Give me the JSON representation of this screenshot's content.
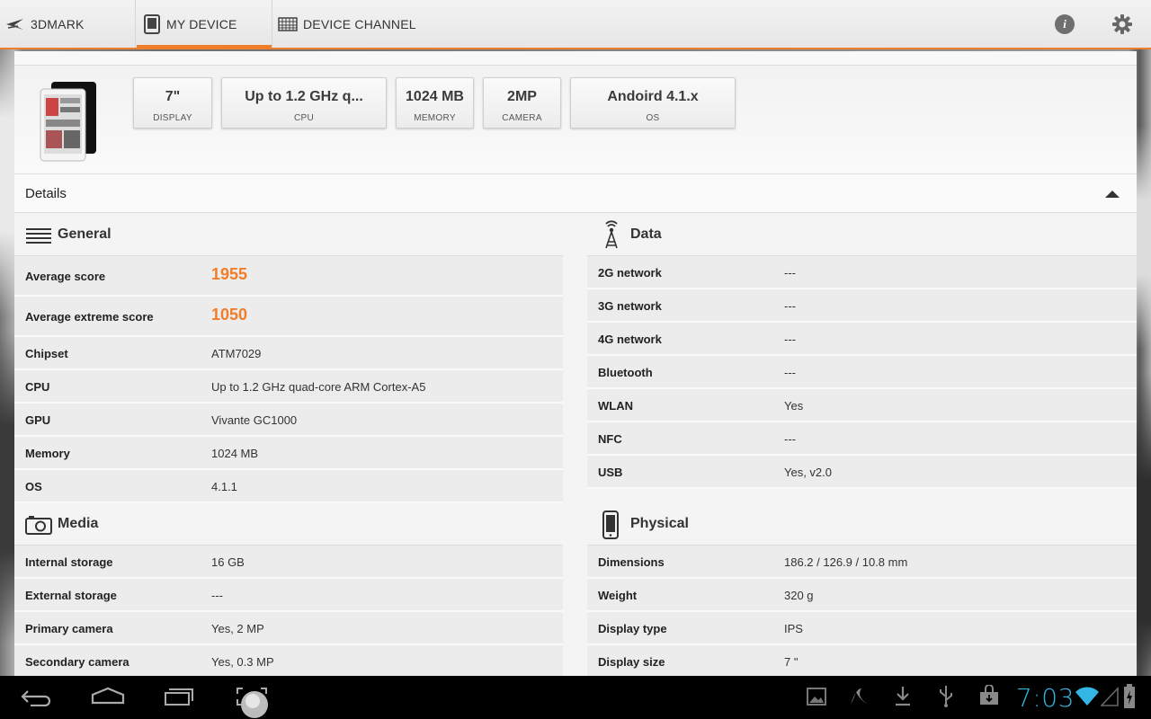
{
  "topbar": {
    "tabs": [
      {
        "label": "3DMARK"
      },
      {
        "label": "MY DEVICE",
        "selected": true
      },
      {
        "label": "DEVICE CHANNEL"
      }
    ],
    "info_icon_glyph": "i",
    "accent_color": "#f07d2a"
  },
  "summary": {
    "cards": [
      {
        "value": "7\"",
        "key": "DISPLAY"
      },
      {
        "value": "Up to 1.2 GHz q...",
        "key": "CPU"
      },
      {
        "value": "1024 MB",
        "key": "MEMORY"
      },
      {
        "value": "2MP",
        "key": "CAMERA"
      },
      {
        "value": "Andoird 4.1.x",
        "key": "OS"
      }
    ]
  },
  "details": {
    "title": "Details",
    "general": {
      "title": "General",
      "rows": [
        {
          "key": "Average score",
          "value": "1955"
        },
        {
          "key": "Average extreme score",
          "value": "1050"
        },
        {
          "key": "Chipset",
          "value": "ATM7029"
        },
        {
          "key": "CPU",
          "value": "Up to 1.2 GHz quad-core ARM Cortex-A5"
        },
        {
          "key": "GPU",
          "value": "Vivante GC1000"
        },
        {
          "key": "Memory",
          "value": "1024 MB"
        },
        {
          "key": "OS",
          "value": "4.1.1"
        }
      ]
    },
    "data": {
      "title": "Data",
      "rows": [
        {
          "key": "2G network",
          "value": "---"
        },
        {
          "key": "3G network",
          "value": "---"
        },
        {
          "key": "4G network",
          "value": "---"
        },
        {
          "key": "Bluetooth",
          "value": "---"
        },
        {
          "key": "WLAN",
          "value": "Yes"
        },
        {
          "key": "NFC",
          "value": "---"
        },
        {
          "key": "USB",
          "value": "Yes, v2.0"
        }
      ]
    },
    "media": {
      "title": "Media",
      "rows": [
        {
          "key": "Internal storage",
          "value": "16 GB"
        },
        {
          "key": "External storage",
          "value": "---"
        },
        {
          "key": "Primary camera",
          "value": "Yes, 2 MP"
        },
        {
          "key": "Secondary camera",
          "value": "Yes, 0.3 MP"
        }
      ]
    },
    "physical": {
      "title": "Physical",
      "rows": [
        {
          "key": "Dimensions",
          "value": "186.2 / 126.9 / 10.8 mm"
        },
        {
          "key": "Weight",
          "value": "320 g"
        },
        {
          "key": "Display type",
          "value": "IPS"
        },
        {
          "key": "Display size",
          "value": "7 \""
        }
      ]
    }
  },
  "statusbar": {
    "clock": "7:03",
    "clock_color": "#33b5e5"
  }
}
